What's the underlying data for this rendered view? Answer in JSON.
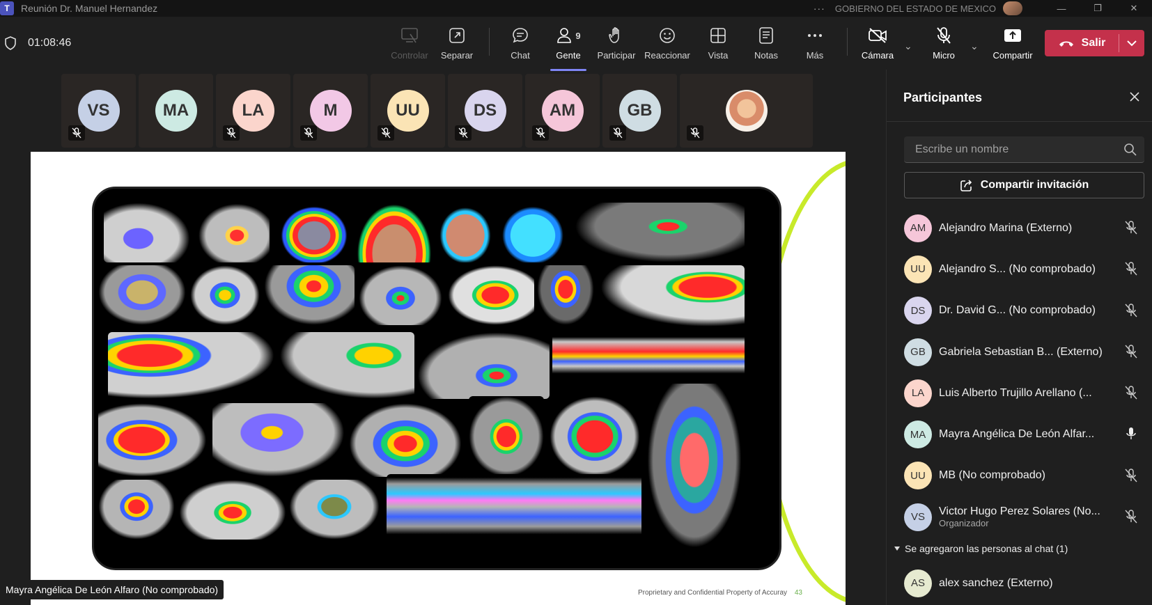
{
  "window": {
    "title": "Reunión Dr. Manuel Hernandez",
    "app_icon": "T",
    "organization": "GOBIERNO DEL ESTADO DE MEXICO",
    "more": "···"
  },
  "toolbar": {
    "timer": "01:08:46",
    "buttons": [
      {
        "label": "Controlar",
        "icon": "control-icon",
        "state": "disabled"
      },
      {
        "label": "Separar",
        "icon": "pop-out-icon"
      },
      {
        "label": "Chat",
        "icon": "chat-icon"
      },
      {
        "label": "Gente",
        "icon": "people-icon",
        "badge": "9",
        "state": "active"
      },
      {
        "label": "Participar",
        "icon": "raise-hand-icon"
      },
      {
        "label": "Reaccionar",
        "icon": "emoji-icon"
      },
      {
        "label": "Vista",
        "icon": "grid-icon"
      },
      {
        "label": "Notas",
        "icon": "notes-icon"
      },
      {
        "label": "Más",
        "icon": "more-icon"
      },
      {
        "label": "Cámara",
        "icon": "camera-off-icon"
      },
      {
        "label": "Micro",
        "icon": "mic-off-icon"
      },
      {
        "label": "Compartir",
        "icon": "share-icon"
      }
    ],
    "leave_label": "Salir",
    "leave_color": "#c4314b"
  },
  "strip": [
    {
      "initials": "VS",
      "color": "#c5d0e6",
      "muted": true
    },
    {
      "initials": "MA",
      "color": "#cdeae3",
      "muted": false
    },
    {
      "initials": "LA",
      "color": "#fbd5cc",
      "muted": true
    },
    {
      "initials": "M",
      "color": "#f2c8e6",
      "muted": true
    },
    {
      "initials": "UU",
      "color": "#fbe4b5",
      "muted": true
    },
    {
      "initials": "DS",
      "color": "#d9d5ee",
      "muted": true
    },
    {
      "initials": "AM",
      "color": "#f5c6d9",
      "muted": true
    },
    {
      "initials": "GB",
      "color": "#cfdde3",
      "muted": true
    },
    {
      "initials": "",
      "photo": true,
      "muted": true
    }
  ],
  "slide": {
    "footer": "Proprietary and Confidential Property of Accuray",
    "page": "43",
    "accent": "#c8ea2a"
  },
  "speaker": "Mayra Angélica De León Alfaro (No comprobado)",
  "panel": {
    "title": "Participantes",
    "search_placeholder": "Escribe un nombre",
    "invite_label": "Compartir invitación",
    "participants": [
      {
        "initials": "AM",
        "color": "#f5c6d9",
        "name": "Alejandro Marina (Externo)",
        "muted": true
      },
      {
        "initials": "UU",
        "color": "#fbe4b5",
        "name": "Alejandro S...  (No comprobado)",
        "muted": true
      },
      {
        "initials": "DS",
        "color": "#d9d5ee",
        "name": "Dr. David G...  (No comprobado)",
        "muted": true
      },
      {
        "initials": "GB",
        "color": "#cfdde3",
        "name": "Gabriela Sebastian B...  (Externo)",
        "muted": true
      },
      {
        "initials": "LA",
        "color": "#fbd5cc",
        "name": "Luis Alberto Trujillo Arellano (...",
        "muted": true
      },
      {
        "initials": "MA",
        "color": "#cdeae3",
        "name": "Mayra Angélica De León Alfar...",
        "muted": false
      },
      {
        "initials": "UU",
        "color": "#fbe4b5",
        "name": "MB (No comprobado)",
        "muted": true
      },
      {
        "initials": "VS",
        "color": "#c5d0e6",
        "name": "Victor Hugo Perez Solares (No...",
        "role": "Organizador",
        "muted": true
      }
    ],
    "added_section": "Se agregaron las personas al chat (1)",
    "added": {
      "initials": "AS",
      "color": "#e6ead0",
      "name": "alex sanchez (Externo)"
    }
  }
}
